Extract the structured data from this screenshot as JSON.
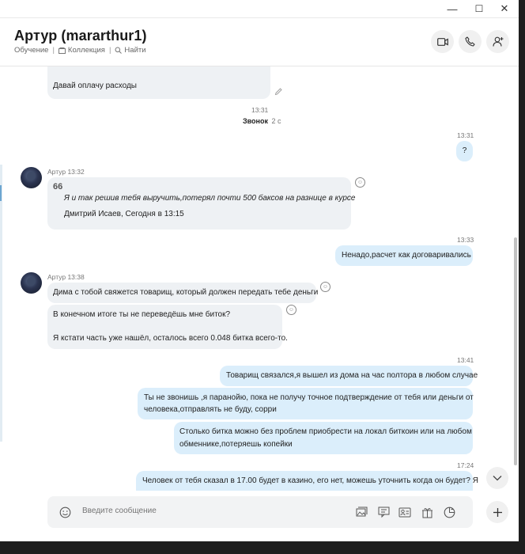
{
  "window": {
    "minimize": "—",
    "maximize": "☐",
    "close": "✕"
  },
  "header": {
    "title": "Артур (mararthur1)",
    "subtitle": {
      "item1": "Обучение",
      "item2": "Коллекция",
      "item3": "Найти",
      "sep": "|"
    }
  },
  "messages": {
    "m1": {
      "line1": "Давай оплачу расходы"
    },
    "call": {
      "time": "13:31",
      "label": "Звонок",
      "duration": "2 с"
    },
    "m2": {
      "time": "13:31",
      "text": "?"
    },
    "m3": {
      "sender": "Артур 13:32",
      "quote_mark": "66",
      "quote_text": "Я и так решив тебя выручить,потерял почти 500 баксов на разнице в курсе",
      "quote_author": "Дмитрий Исаев, Сегодня в 13:15"
    },
    "m4": {
      "time": "13:33",
      "text": "Ненадо,расчет как договаривались"
    },
    "m5": {
      "sender": "Артур 13:38",
      "text": "Дима с тобой свяжется товарищ, который должен передать тебе деньги"
    },
    "m6": {
      "line1": "В конечном итоге ты не переведёшь мне биток?",
      "line2": "Я кстати часть уже нашёл, осталось всего 0.048 битка всего-то."
    },
    "m7": {
      "time": "13:41",
      "text": "Товарищ связался,я вышел из дома на час полтора в любом случае"
    },
    "m8": {
      "line1": "Ты не звонишь ,я паранойю, пока не получу точное подтверждение от тебя или деньги от",
      "line2": "человека,отправлять не буду, сорри"
    },
    "m9": {
      "line1": "Столько битка можно без проблем приобрести на локал биткоин или на любом",
      "line2": "обменнике,потеряешь копейки"
    },
    "m10": {
      "time": "17:24",
      "text": "Человек от тебя сказал в 17.00 будет в казино, его нет, можешь уточнить когда он будет? Я"
    }
  },
  "compose": {
    "placeholder": "Введите сообщение"
  },
  "icons": {
    "video": "video-camera-icon",
    "call": "phone-icon",
    "add_people": "add-person-icon",
    "emoji": "smiley-icon",
    "media": "image-icon",
    "file": "file-icon",
    "contact": "contact-card-icon",
    "gift": "gift-icon",
    "poll": "poll-icon",
    "scroll_down": "chevron-down-icon",
    "plus": "plus-icon",
    "edit": "pencil-icon",
    "react": "reaction-smiley-icon"
  },
  "colors": {
    "incoming_bubble": "#eef1f4",
    "outgoing_bubble": "#dbeefb",
    "accent": "#6da6d1"
  }
}
